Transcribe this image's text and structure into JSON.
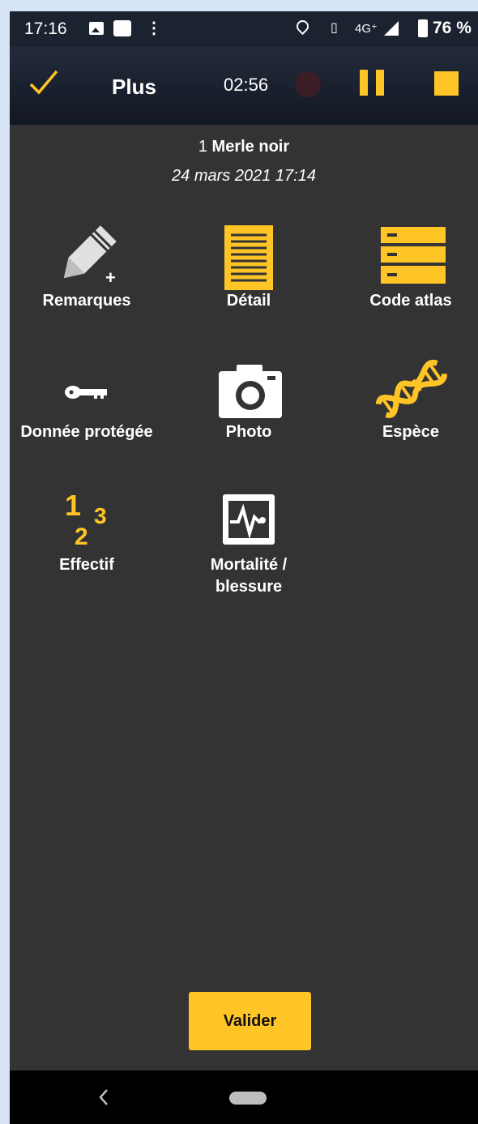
{
  "status_bar": {
    "time": "17:16",
    "network": "4G⁺",
    "battery": "76 %",
    "icons": [
      "image-icon",
      "app-icon",
      "more-icon",
      "location-icon",
      "vibrate-icon",
      "signal-icon",
      "battery-icon"
    ]
  },
  "app_bar": {
    "title": "Plus",
    "timer": "02:56",
    "icons": [
      "check-icon",
      "record-icon",
      "pause-icon",
      "stop-icon"
    ]
  },
  "observation": {
    "count": "1",
    "species": "Merle noir",
    "datetime": "24 mars 2021 17:14"
  },
  "tiles": [
    {
      "label": "Remarques",
      "icon": "pencil-plus-icon"
    },
    {
      "label": "Détail",
      "icon": "document-icon"
    },
    {
      "label": "Code atlas",
      "icon": "list-code-icon"
    },
    {
      "label": "Donnée protégée",
      "icon": "key-icon"
    },
    {
      "label": "Photo",
      "icon": "camera-icon"
    },
    {
      "label": "Espèce",
      "icon": "dna-icon"
    },
    {
      "label": "Effectif",
      "icon": "numbers-icon"
    },
    {
      "label": "Mortalité /",
      "label_line2": "blessure",
      "icon": "heart-monitor-icon"
    }
  ],
  "actions": {
    "validate_label": "Valider"
  },
  "colors": {
    "accent": "#ffc527",
    "background": "#333333",
    "appbar": "#1b2230"
  }
}
